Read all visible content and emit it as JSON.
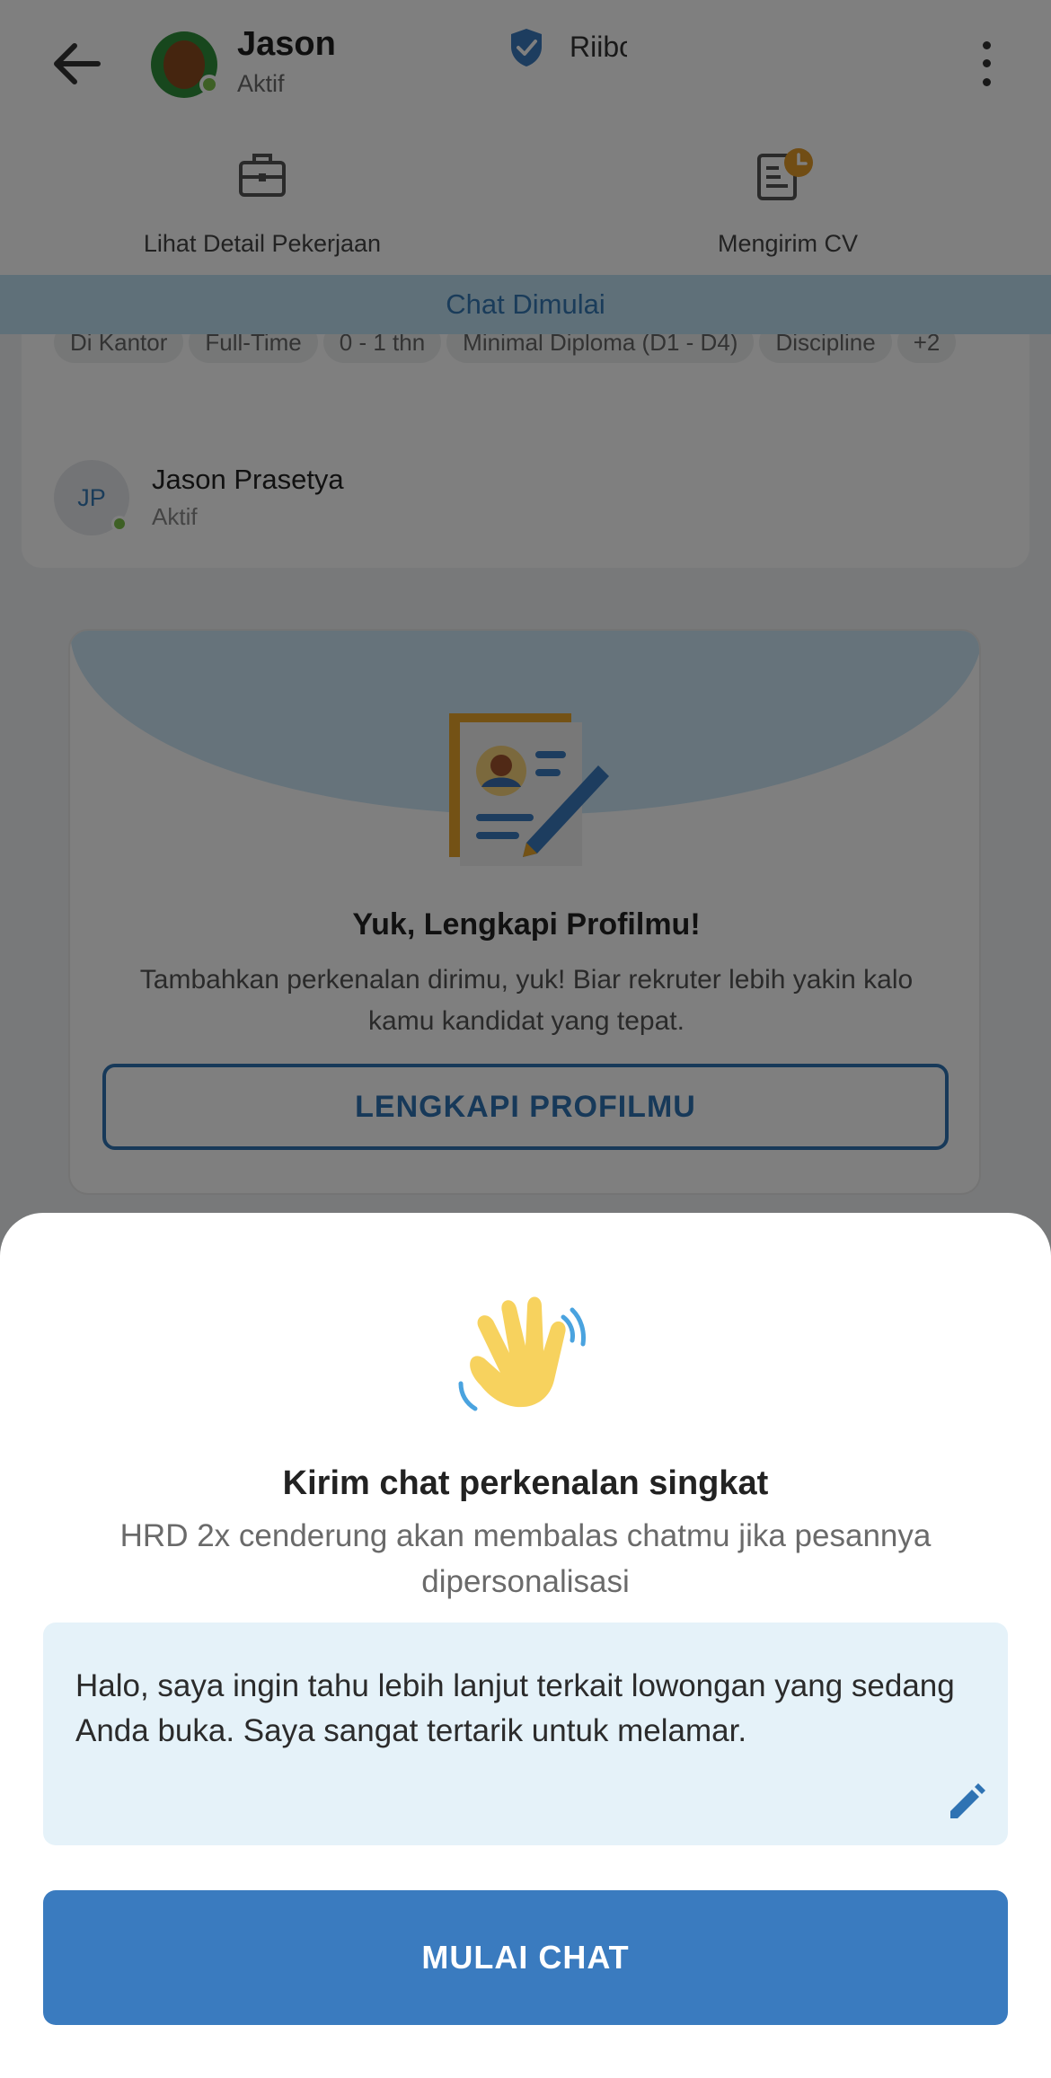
{
  "header": {
    "user_name": "Jason",
    "user_status": "Aktif",
    "company_name": "Riibo",
    "back_icon": "arrow-left-icon",
    "more_icon": "more-vertical-icon"
  },
  "actions": [
    {
      "label": "Lihat Detail Pekerjaan",
      "icon": "briefcase-icon"
    },
    {
      "label": "Mengirim CV",
      "icon": "document-clock-icon"
    }
  ],
  "chat_banner": "Chat Dimulai",
  "job_card": {
    "tags": [
      "Di Kantor",
      "Full-Time",
      "0 - 1 thn",
      "Minimal Diploma (D1 - D4)",
      "Discipline",
      "+2"
    ],
    "recruiter": {
      "initials": "JP",
      "name": "Jason Prasetya",
      "status": "Aktif"
    }
  },
  "profile_card": {
    "title": "Yuk, Lengkapi Profilmu!",
    "description": "Tambahkan perkenalan dirimu, yuk! Biar rekruter lebih yakin kalo kamu kandidat yang tepat.",
    "button_label": "LENGKAPI PROFILMU"
  },
  "sheet": {
    "icon": "waving-hand-icon",
    "title": "Kirim chat perkenalan singkat",
    "subtitle": "HRD 2x cenderung akan membalas chatmu jika pesannya dipersonalisasi",
    "message": "Halo, saya ingin tahu lebih lanjut terkait lowongan yang sedang Anda buka. Saya sangat tertarik untuk melamar.",
    "edit_icon": "pencil-icon",
    "button_label": "MULAI CHAT"
  },
  "colors": {
    "primary": "#3a7bbf",
    "banner_bg": "#bfe0f2",
    "message_bg": "#e5f2f9",
    "online": "#7cc04b"
  }
}
